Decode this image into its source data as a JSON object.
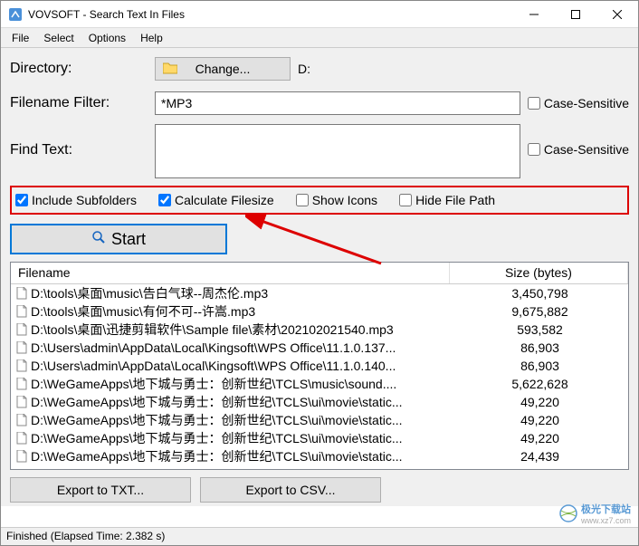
{
  "window": {
    "title": "VOVSOFT - Search Text In Files"
  },
  "menu": {
    "items": [
      "File",
      "Select",
      "Options",
      "Help"
    ]
  },
  "labels": {
    "directory": "Directory:",
    "filename_filter": "Filename Filter:",
    "find_text": "Find Text:",
    "change_btn": "Change...",
    "case_sensitive": "Case-Sensitive",
    "start_btn": "Start",
    "export_txt": "Export to TXT...",
    "export_csv": "Export to CSV..."
  },
  "directory_value": "D:",
  "filter_value": "*MP3",
  "find_text_value": "",
  "options": {
    "include_subfolders": {
      "label": "Include Subfolders",
      "checked": true
    },
    "calculate_filesize": {
      "label": "Calculate Filesize",
      "checked": true
    },
    "show_icons": {
      "label": "Show Icons",
      "checked": false
    },
    "hide_file_path": {
      "label": "Hide File Path",
      "checked": false
    }
  },
  "table": {
    "headers": {
      "filename": "Filename",
      "size": "Size (bytes)"
    },
    "rows": [
      {
        "name": "D:\\tools\\桌面\\music\\告白气球--周杰伦.mp3",
        "size": "3,450,798"
      },
      {
        "name": "D:\\tools\\桌面\\music\\有何不可--许嵩.mp3",
        "size": "9,675,882"
      },
      {
        "name": "D:\\tools\\桌面\\迅捷剪辑软件\\Sample file\\素材\\202102021540.mp3",
        "size": "593,582"
      },
      {
        "name": "D:\\Users\\admin\\AppData\\Local\\Kingsoft\\WPS Office\\11.1.0.137...",
        "size": "86,903"
      },
      {
        "name": "D:\\Users\\admin\\AppData\\Local\\Kingsoft\\WPS Office\\11.1.0.140...",
        "size": "86,903"
      },
      {
        "name": "D:\\WeGameApps\\地下城与勇士：创新世纪\\TCLS\\music\\sound....",
        "size": "5,622,628"
      },
      {
        "name": "D:\\WeGameApps\\地下城与勇士：创新世纪\\TCLS\\ui\\movie\\static...",
        "size": "49,220"
      },
      {
        "name": "D:\\WeGameApps\\地下城与勇士：创新世纪\\TCLS\\ui\\movie\\static...",
        "size": "49,220"
      },
      {
        "name": "D:\\WeGameApps\\地下城与勇士：创新世纪\\TCLS\\ui\\movie\\static...",
        "size": "49,220"
      },
      {
        "name": "D:\\WeGameApps\\地下城与勇士：创新世纪\\TCLS\\ui\\movie\\static...",
        "size": "24,439"
      }
    ]
  },
  "status": "Finished (Elapsed Time: 2.382 s)",
  "watermark": {
    "name": "极光下载站",
    "url": "www.xz7.com"
  }
}
